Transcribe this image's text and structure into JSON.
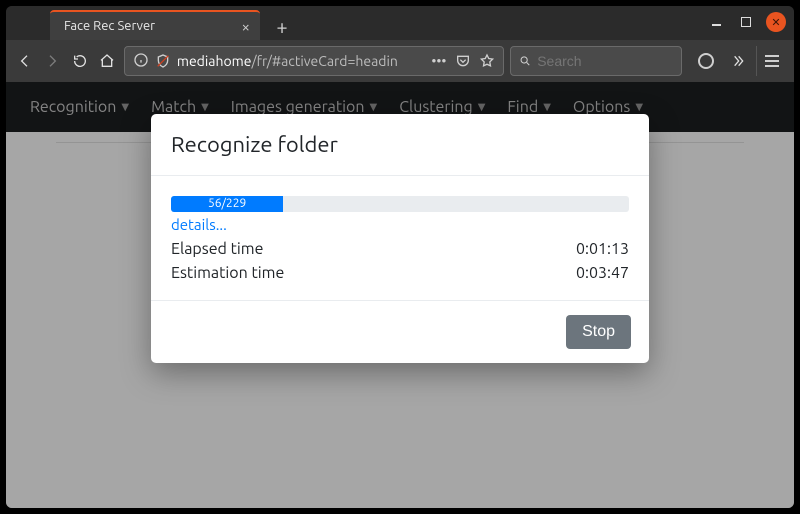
{
  "window": {
    "tab_title": "Face Rec Server",
    "close_glyph": "×",
    "newtab_glyph": "+"
  },
  "toolbar": {
    "url_host": "mediahome",
    "url_rest": "/fr/#activeCard=headin",
    "search_placeholder": "Search",
    "reader_dots": "•••"
  },
  "app_nav": {
    "items": [
      "Recognition",
      "Match",
      "Images generation",
      "Clustering",
      "Find",
      "Options"
    ],
    "caret": "▼"
  },
  "modal": {
    "title": "Recognize folder",
    "progress": {
      "done": 56,
      "total": 229,
      "label": "56/229",
      "percent": 24.5
    },
    "details_label": "details...",
    "elapsed_label": "Elapsed time",
    "elapsed_value": "0:01:13",
    "estimation_label": "Estimation time",
    "estimation_value": "0:03:47",
    "stop_label": "Stop"
  }
}
